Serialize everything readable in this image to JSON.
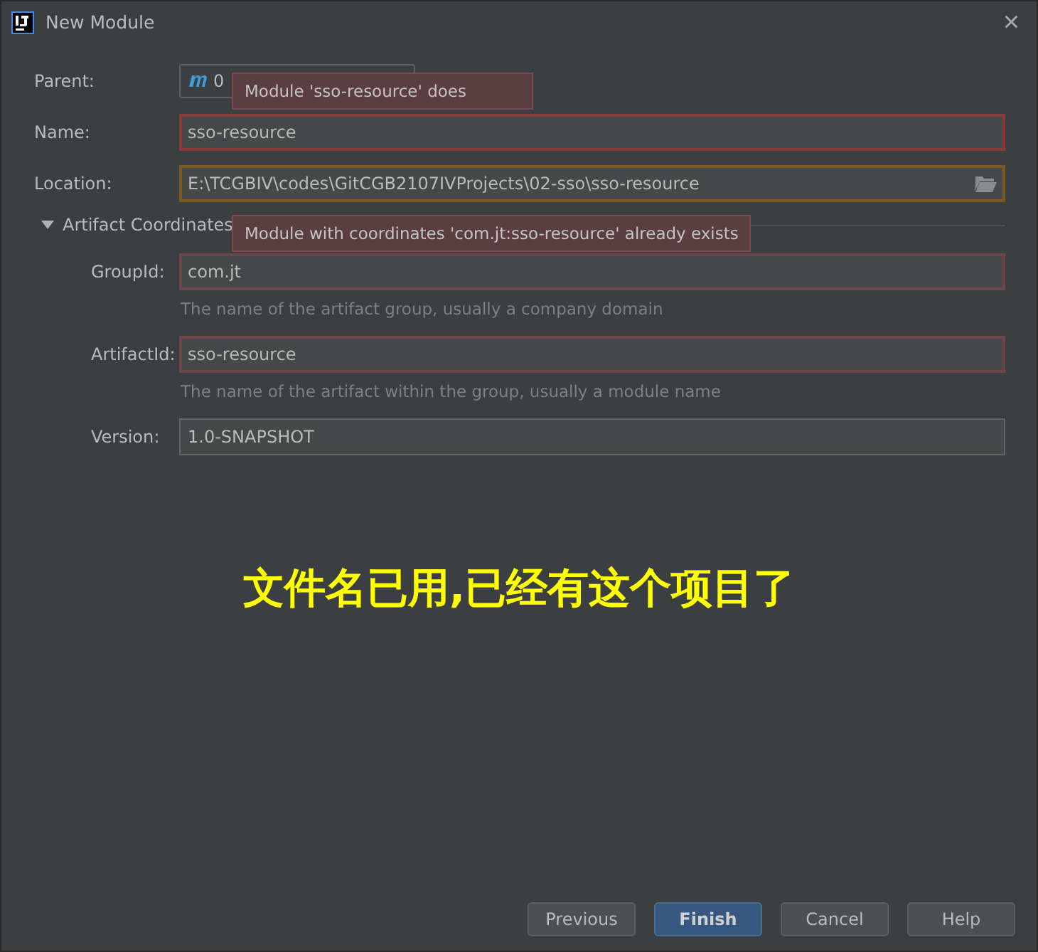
{
  "window": {
    "title": "New Module",
    "close": "×"
  },
  "form": {
    "parent": {
      "label": "Parent:",
      "value": "0"
    },
    "fields": [
      {
        "label": "Name:",
        "value": "sso-resource",
        "kind": "error",
        "browse": false
      },
      {
        "label": "Location:",
        "value": "E:\\TCGBIV\\codes\\GitCGB2107IVProjects\\02-sso\\sso-resource",
        "kind": "warning",
        "browse": true
      }
    ],
    "section": {
      "title": "Artifact Coordinates",
      "expanded": true,
      "fields": [
        {
          "label": "GroupId:",
          "value": "com.jt",
          "kind": "muted_error",
          "hint": "The name of the artifact group, usually a company domain"
        },
        {
          "label": "ArtifactId:",
          "value": "sso-resource",
          "kind": "muted_error",
          "hint": "The name of the artifact within the group, usually a module name"
        },
        {
          "label": "Version:",
          "value": "1.0-SNAPSHOT",
          "kind": "plain"
        }
      ]
    }
  },
  "tooltips": [
    {
      "text": "Module 'sso-resource' does"
    },
    {
      "text": "Module with coordinates 'com.jt:sso-resource' already exists"
    }
  ],
  "annotation": "文件名已用,已经有这个项目了",
  "buttons": [
    {
      "label": "Previous",
      "default": false
    },
    {
      "label": "Finish",
      "default": true
    },
    {
      "label": "Cancel",
      "default": false
    },
    {
      "label": "Help",
      "default": false
    }
  ]
}
